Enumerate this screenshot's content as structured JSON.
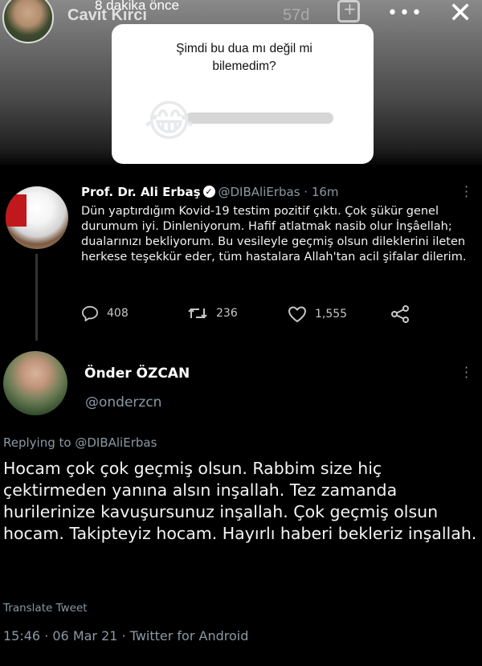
{
  "story": {
    "time_ago": "8 dakika önce",
    "username": "Cavit Kırcı",
    "faded_count": "57d"
  },
  "poll": {
    "question": "Şimdi bu dua mı değil mi bilemedim?",
    "emoji": "😂",
    "slider_fill_fraction": 0.0
  },
  "tweet1": {
    "name": "Prof. Dr. Ali Erbaş",
    "verified_icon": "✓",
    "handle_time": "@DIBAliErbas · 16m",
    "text": "Dün yaptırdığım Kovid-19 testim pozitif çıktı. Çok şükür genel durumum iyi. Dinleniyorum. Hafif atlatmak nasib olur İnşâellah; dualarınızı bekliyorum. Bu vesileyle geçmiş olsun dileklerini ileten herkese teşekkür eder, tüm hastalara Allah'tan acil şifalar dilerim.",
    "replies": "408",
    "retweets": "236",
    "likes": "1,555",
    "icons": [
      "reply-icon",
      "retweet-icon",
      "like-icon",
      "share-icon"
    ]
  },
  "tweet2": {
    "name": "Önder ÖZCAN",
    "handle": "@onderzcn",
    "replying_prefix": "Replying to",
    "replying_to": "@DIBAliErbas",
    "text": "Hocam çok çok geçmiş olsun. Rabbim size hiç çektirmeden yanına alsın inşallah. Tez zamanda hurilerinize kavuşursunuz inşallah. Çok geçmiş olsun hocam. Takipteyiz hocam. Hayırlı haberi bekleriz inşallah.",
    "translate": "Translate Tweet",
    "timestamp": "15:46 · 06 Mar 21 · Twitter for Android"
  },
  "colors": {
    "background": "#000000",
    "muted_text": "#8b98a5",
    "card": "#ffffff"
  }
}
